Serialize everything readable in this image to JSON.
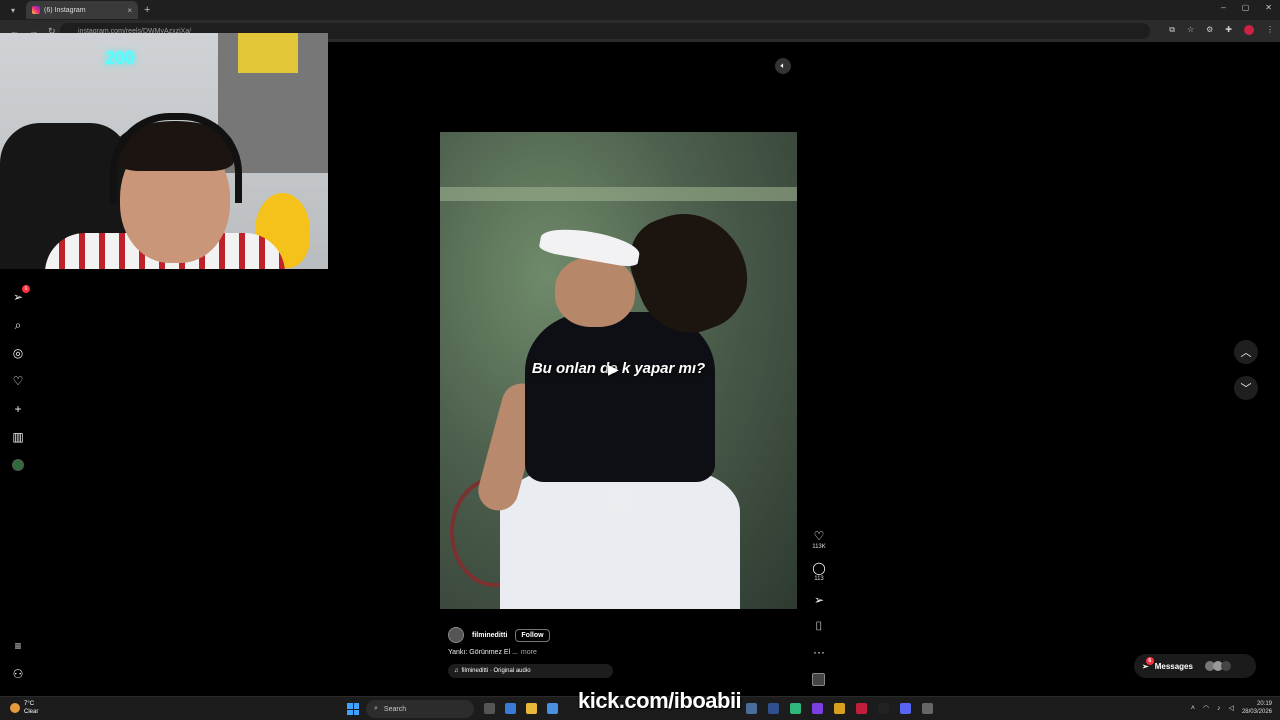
{
  "browser": {
    "tab_title": "(6) Instagram",
    "tab_close": "×",
    "new_tab": "+",
    "url": "instagram.com/reels/DWMyAzxzjXa/",
    "win_min": "–",
    "win_max": "▢",
    "win_close": "✕"
  },
  "nav": {
    "notifications_badge": "6"
  },
  "reel": {
    "caption": "Bu onlan de  k yapar mı?",
    "watermark_line1": "filmin",
    "watermark_line2": "editi",
    "author": "filmineditti",
    "follow_label": "Follow",
    "description": "Yankı: Görünmez El ...",
    "more_label": "more",
    "audio": "filmineditti · Original audio",
    "likes": "113K",
    "comments": "113",
    "more_options": "···"
  },
  "messages": {
    "label": "Messages",
    "badge": "6"
  },
  "overlay": {
    "kick_text": "kick.com/iboabii",
    "neon_text": "200"
  },
  "taskbar": {
    "temp": "7°C",
    "weather": "Clear",
    "search_label": "Search",
    "time": "20:19",
    "date": "28/03/2026"
  },
  "colors": {
    "accent_notification": "#ff3040",
    "page_bg": "#000000"
  }
}
